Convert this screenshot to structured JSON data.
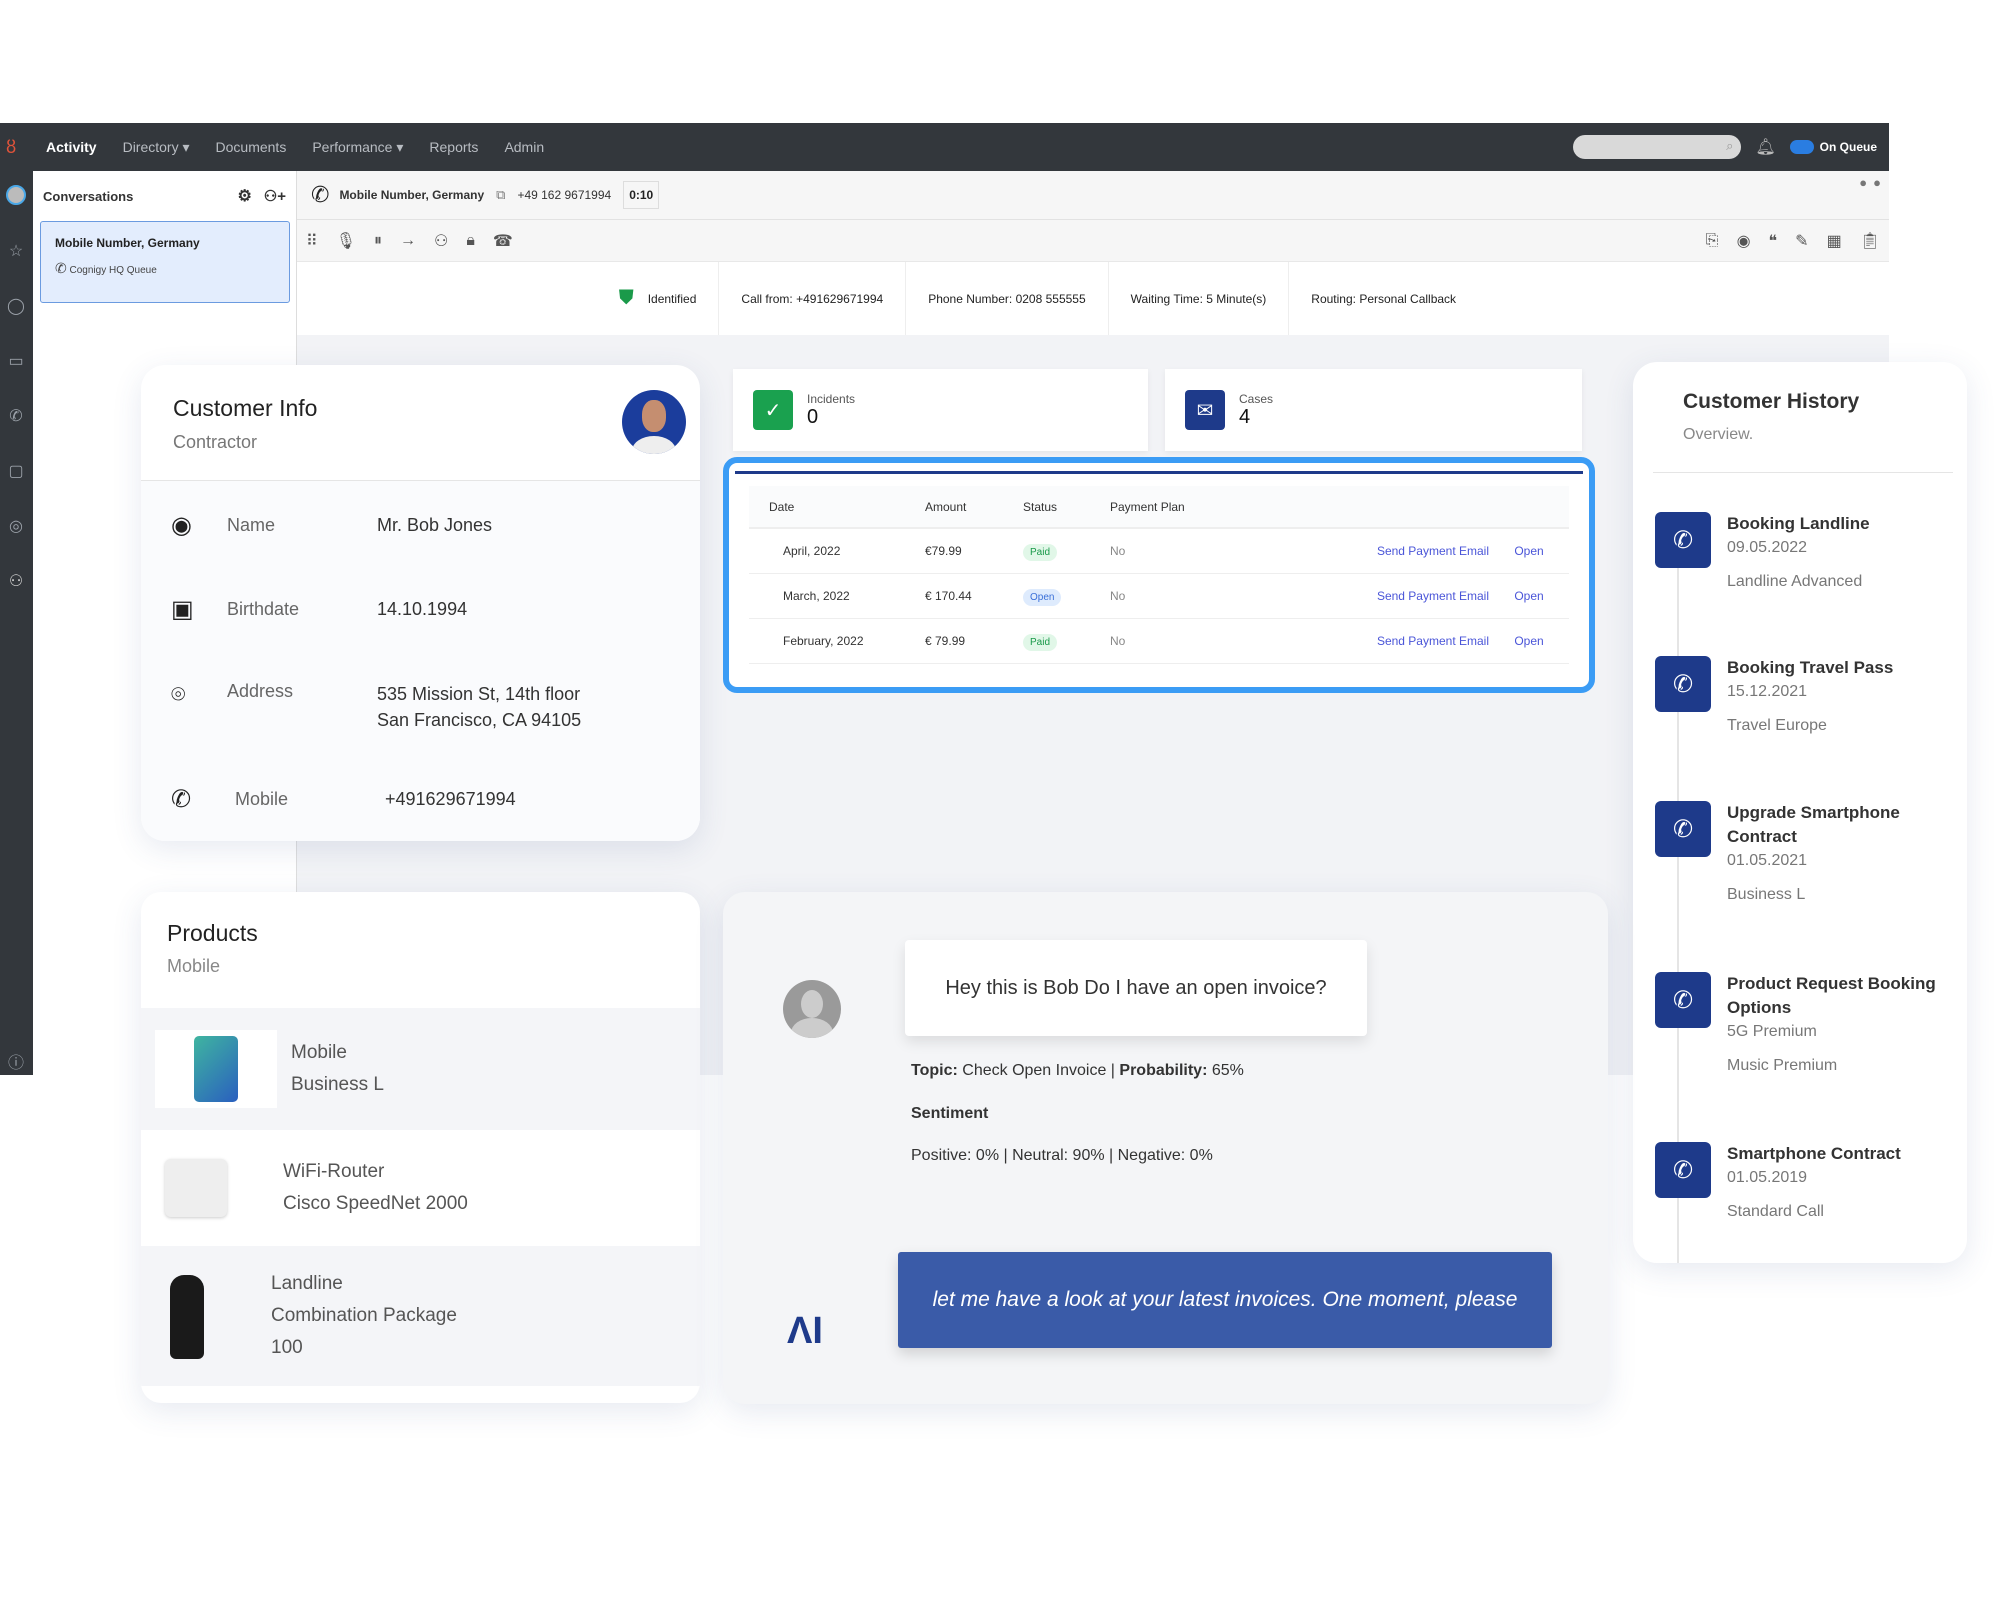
{
  "topbar": {
    "nav": [
      "Activity",
      "Directory",
      "Documents",
      "Performance",
      "Reports",
      "Admin"
    ],
    "status": "On Queue",
    "search_placeholder": ""
  },
  "conversations": {
    "title": "Conversations",
    "item": {
      "title": "Mobile Number, Germany",
      "queue": "Cognigy HQ Queue"
    }
  },
  "call": {
    "title": "Mobile Number, Germany",
    "number": "+49 162 9671994",
    "timer": "0:10"
  },
  "strip": {
    "identified": "Identified",
    "call_from_label": "Call from:",
    "call_from": "+491629671994",
    "phone_label": "Phone Number:",
    "phone": "0208 555555",
    "wait_label": "Waiting Time:",
    "wait": "5 Minute(s)",
    "routing_label": "Routing:",
    "routing": "Personal Callback"
  },
  "customer": {
    "title": "Customer Info",
    "subtitle": "Contractor",
    "fields": [
      {
        "label": "Name",
        "value": "Mr. Bob Jones"
      },
      {
        "label": "Birthdate",
        "value": "14.10.1994"
      },
      {
        "label": "Address",
        "value": "535 Mission St, 14th floor",
        "value2": "San Francisco, CA 94105"
      },
      {
        "label": "Mobile",
        "value": "+491629671994"
      }
    ]
  },
  "kpis": {
    "incidents_label": "Incidents",
    "incidents": "0",
    "cases_label": "Cases",
    "cases": "4"
  },
  "invoices": {
    "headers": [
      "Date",
      "Amount",
      "Status",
      "Payment Plan"
    ],
    "rows": [
      {
        "date": "April, 2022",
        "amount": "€79.99",
        "status": "Paid",
        "plan": "No",
        "action": "Send Payment Email",
        "open": "Open"
      },
      {
        "date": "March, 2022",
        "amount": "€ 170.44",
        "status": "Open",
        "plan": "No",
        "action": "Send Payment Email",
        "open": "Open"
      },
      {
        "date": "February, 2022",
        "amount": "€ 79.99",
        "status": "Paid",
        "plan": "No",
        "action": "Send Payment Email",
        "open": "Open"
      }
    ]
  },
  "colors": {
    "accent": "#1e3a8a",
    "highlight": "#3b9cf5",
    "paid": "#1a9a4a",
    "open": "#3a6fd8",
    "ai_bubble": "#3a5ba8"
  },
  "history": {
    "title": "Customer History",
    "subtitle": "Overview.",
    "items": [
      {
        "title": "Booking Landline",
        "lines": [
          "09.05.2022",
          "Landline Advanced"
        ]
      },
      {
        "title": "Booking Travel Pass",
        "lines": [
          "15.12.2021",
          "Travel Europe"
        ]
      },
      {
        "title": "Upgrade Smartphone Contract",
        "lines": [
          "01.05.2021",
          "Business L"
        ]
      },
      {
        "title": "Product Request Booking Options",
        "lines": [
          "5G Premium",
          "Music Premium"
        ]
      },
      {
        "title": "Smartphone Contract",
        "lines": [
          "01.05.2019",
          "Standard Call"
        ]
      }
    ]
  },
  "products": {
    "title": "Products",
    "subtitle": "Mobile",
    "items": [
      {
        "name": "Mobile",
        "detail": "Business L",
        "detail2": ""
      },
      {
        "name": "WiFi-Router",
        "detail": "Cisco SpeedNet 2000",
        "detail2": ""
      },
      {
        "name": "Landline",
        "detail": "Combination Package",
        "detail2": "100"
      }
    ]
  },
  "chat": {
    "user_msg": "Hey this is Bob Do I have an open invoice?",
    "topic_label": "Topic:",
    "topic": "Check Open Invoice",
    "prob_label": "Probability:",
    "prob": "65%",
    "sentiment_title": "Sentiment",
    "sentiment": "Positive: 0% | Neutral: 90% | Negative: 0%",
    "ai_logo": "ΛI",
    "ai_msg": "let me have a look at your latest invoices. One moment, please"
  }
}
